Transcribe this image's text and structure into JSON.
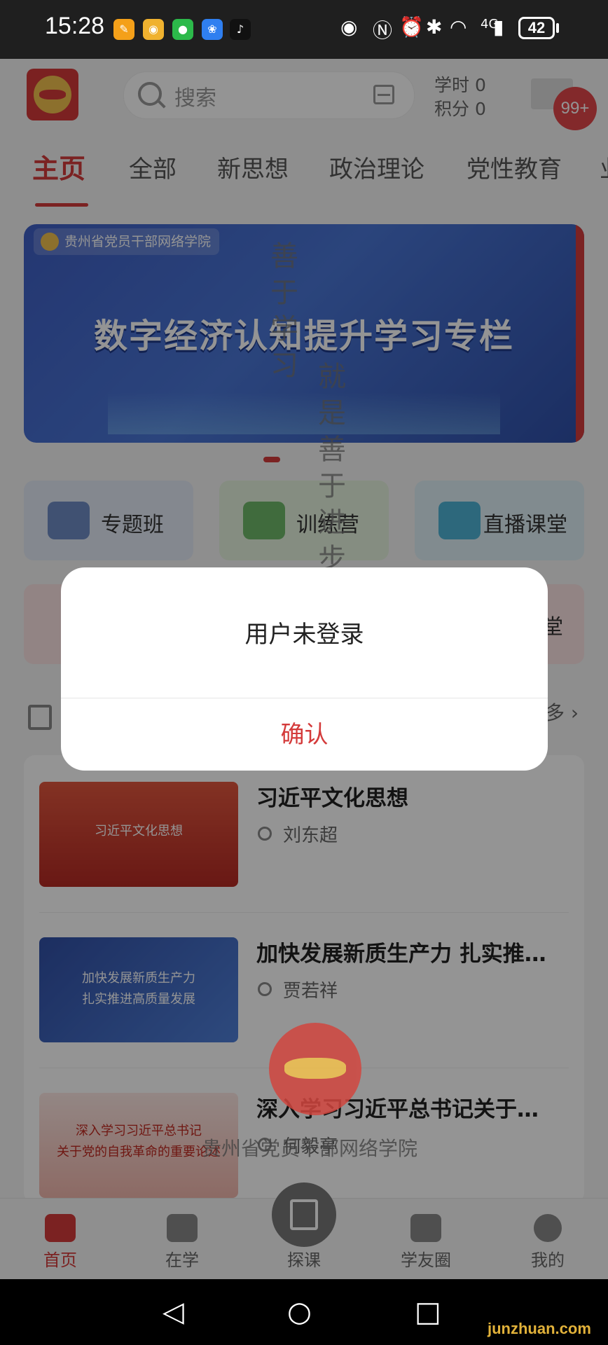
{
  "status_bar": {
    "time": "15:28",
    "network": "4G",
    "battery": "42"
  },
  "header": {
    "search_placeholder": "搜索",
    "study_hours": "学时 0",
    "points": "积分 0",
    "message_badge": "99+"
  },
  "tabs": [
    "主页",
    "全部",
    "新思想",
    "政治理论",
    "党性教育",
    "业"
  ],
  "banner": {
    "tag": "贵州省党员干部网络学院",
    "title": "数字经济认知提升学习专栏"
  },
  "features": [
    "专题班",
    "训练营",
    "直播课堂"
  ],
  "row2_partial": [
    "堂"
  ],
  "section": {
    "more": "多"
  },
  "courses": [
    {
      "thumb_text": "习近平文化思想",
      "title": "习近平文化思想",
      "author": "刘东超"
    },
    {
      "thumb_text": "加快发展新质生产力\n扎实推进高质量发展",
      "title": "加快发展新质生产力 扎实推…",
      "author": "贾若祥"
    },
    {
      "thumb_text": "深入学习习近平总书记\n关于党的自我革命的重要论述",
      "title": "深入学习习近平总书记关于…",
      "author": "何毅亭"
    }
  ],
  "bottom_nav": [
    "首页",
    "在学",
    "探课",
    "学友圈",
    "我的"
  ],
  "watermark": {
    "col1": "善于学习",
    "col2": "就是善于进步",
    "org": "贵州省党员干部网络学院"
  },
  "dialog": {
    "message": "用户未登录",
    "confirm": "确认"
  },
  "site_watermark": "junzhuan.com",
  "colors": {
    "accent": "#d43b3b",
    "overlay": "rgba(0,0,0,0.42)"
  }
}
